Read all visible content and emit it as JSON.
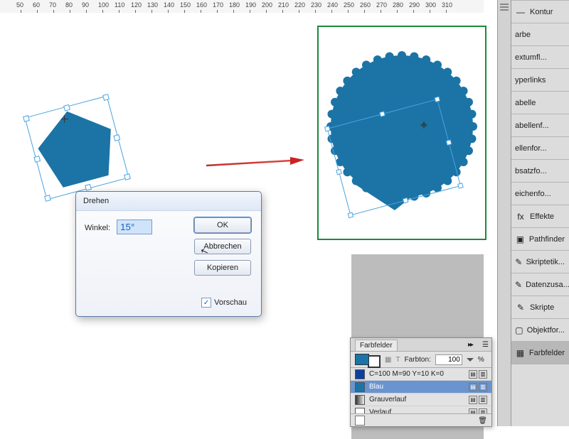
{
  "ruler": {
    "start": 50,
    "end": 310,
    "step": 10
  },
  "dialog": {
    "title": "Drehen",
    "angle_label": "Winkel:",
    "angle_value": "15°",
    "ok": "OK",
    "cancel": "Abbrechen",
    "copy": "Kopieren",
    "preview": "Vorschau"
  },
  "sidebar": {
    "items": [
      {
        "label": "Kontur",
        "icon": "—"
      },
      {
        "label": "arbe",
        "icon": ""
      },
      {
        "label": "extumfl...",
        "icon": ""
      },
      {
        "label": "yperlinks",
        "icon": ""
      },
      {
        "label": "abelle",
        "icon": ""
      },
      {
        "label": "abellenf...",
        "icon": ""
      },
      {
        "label": "ellenfor...",
        "icon": ""
      },
      {
        "label": "bsatzfo...",
        "icon": ""
      },
      {
        "label": "eichenfo...",
        "icon": ""
      },
      {
        "label": "Effekte",
        "icon": "fx"
      },
      {
        "label": "Pathfinder",
        "icon": "▣"
      },
      {
        "label": "Skriptetik...",
        "icon": "✎"
      },
      {
        "label": "Datenzusa...",
        "icon": "✎"
      },
      {
        "label": "Skripte",
        "icon": "✎"
      },
      {
        "label": "Objektfor...",
        "icon": "▢"
      },
      {
        "label": "Farbfelder",
        "icon": "▦"
      }
    ]
  },
  "swatches": {
    "tab": "Farbfelder",
    "farbton_label": "Farbton:",
    "farbton_value": "100",
    "farbton_unit": "%",
    "rows": [
      {
        "color": "#0f3f9e",
        "name": "C=100 M=90 Y=10 K=0",
        "sel": false
      },
      {
        "color": "#1b74a5",
        "name": "Blau",
        "sel": true
      },
      {
        "color": "linear",
        "name": "Grauverlauf",
        "sel": false
      },
      {
        "color": "#fff",
        "name": "Verlauf",
        "sel": false
      }
    ]
  },
  "colors": {
    "shape": "#1b74a5",
    "select": "#4aa3e0"
  }
}
